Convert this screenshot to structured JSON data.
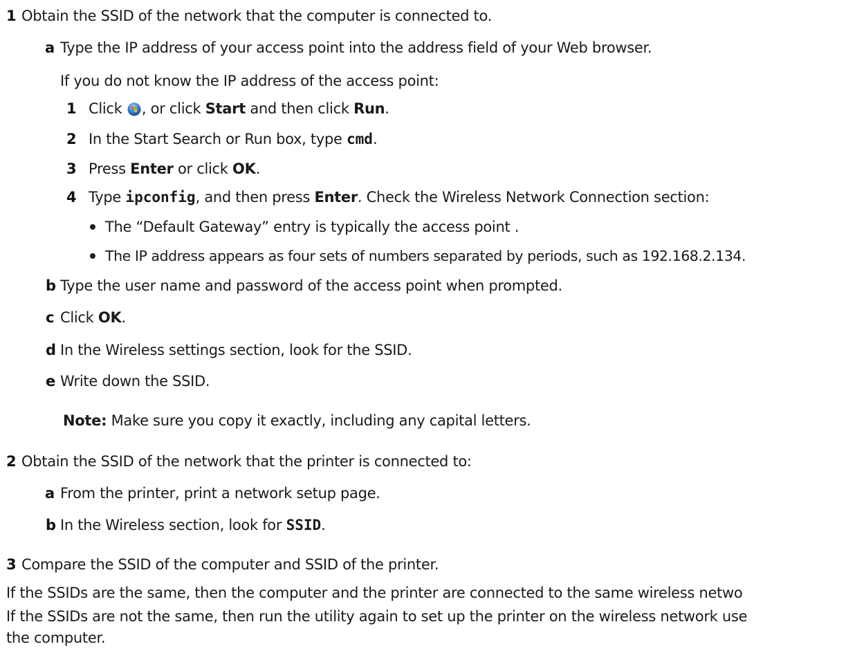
{
  "steps": {
    "s1": {
      "num": "1",
      "text": "Obtain the SSID of the network that the computer is connected to.",
      "a": {
        "label": "a",
        "text": "Type the IP address of your access point into the address field of your Web browser.",
        "note_intro": "If you do not know the IP address of the access point:",
        "sub": {
          "n1": {
            "num": "1",
            "t1": "Click ",
            "t2": ", or click ",
            "b1": "Start",
            "t3": " and then click ",
            "b2": "Run",
            "t4": "."
          },
          "n2": {
            "num": "2",
            "t1": "In the Start Search or Run box, type ",
            "code": "cmd",
            "t2": "."
          },
          "n3": {
            "num": "3",
            "t1": "Press ",
            "b1": "Enter",
            "t2": " or click ",
            "b2": "OK",
            "t3": "."
          },
          "n4": {
            "num": "4",
            "t1": "Type ",
            "code": "ipconfig",
            "t2": ", and then press ",
            "b1": "Enter",
            "t3": ". Check the Wireless Network Connection section:"
          },
          "bullets": [
            "The “Default Gateway” entry is typically the access point .",
            "The IP address appears as four sets of numbers separated by periods, such as 192.168.2.134."
          ]
        }
      },
      "b": {
        "label": "b",
        "text": "Type the user name and password of the access point when prompted."
      },
      "c": {
        "label": "c",
        "t1": "Click ",
        "b1": "OK",
        "t2": "."
      },
      "d": {
        "label": "d",
        "text": "In the Wireless settings section, look for the SSID."
      },
      "e": {
        "label": "e",
        "text": "Write down the SSID."
      },
      "note": {
        "label": "Note:",
        "text": " Make sure you copy it exactly, including any capital letters."
      }
    },
    "s2": {
      "num": "2",
      "text": "Obtain the SSID of the network that the printer is connected to:",
      "a": {
        "label": "a",
        "text": "From the printer, print a network setup page."
      },
      "b": {
        "label": "b",
        "t1": "In the Wireless section, look for ",
        "code": "SSID",
        "t2": "."
      }
    },
    "s3": {
      "num": "3",
      "text": "Compare the SSID of the computer and SSID of the printer.",
      "p1": "If the SSIDs are the same, then the computer and the printer are connected to the same wireless netwo",
      "p2": "If the SSIDs are not the same, then run the utility again to set up the printer on the wireless network use",
      "p3": "the computer."
    }
  },
  "icons": {
    "start_orb": "windows-start-orb-icon"
  },
  "colors": {
    "text": "#1a1a1a",
    "orb_blue": "#3a7bd5"
  }
}
